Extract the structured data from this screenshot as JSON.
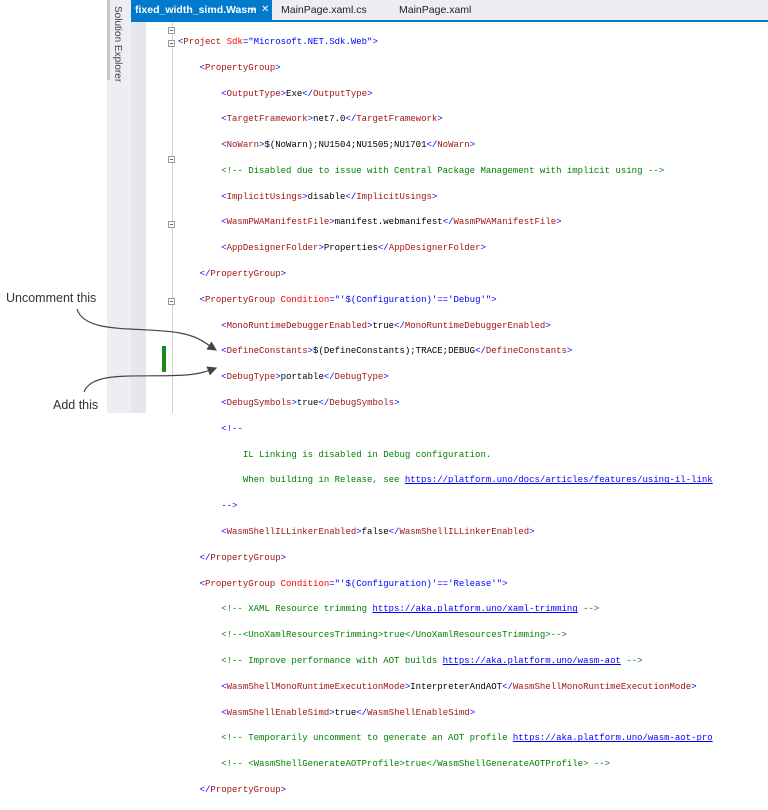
{
  "sidebar": {
    "solution_explorer": "Solution Explorer"
  },
  "tabs": [
    {
      "label": "fixed_width_simd.Wasm",
      "active": true,
      "pin_icon": "pin-icon",
      "close_icon": "close-icon"
    },
    {
      "label": "MainPage.xaml.cs"
    },
    {
      "label": "MainPage.xaml"
    }
  ],
  "annotations": {
    "uncomment": "Uncomment this",
    "add": "Add this"
  },
  "colors": {
    "accent": "#007acc",
    "tag": "#a31515",
    "bracket": "#0000ff",
    "comment": "#008000",
    "change_marker": "#1a8a1a"
  },
  "code": {
    "l0": [
      "<",
      "Project",
      " Sdk",
      "=\"Microsoft.NET.Sdk.Web\"",
      ">"
    ],
    "l1": [
      "PropertyGroup"
    ],
    "l2": [
      "OutputType",
      "Exe"
    ],
    "l3": [
      "TargetFramework",
      "net7.0"
    ],
    "l4": [
      "NoWarn",
      "$(NoWarn);NU1504;NU1505;NU1701"
    ],
    "l5": "<!-- Disabled due to issue with Central Package Management with implicit using -->",
    "l6": [
      "ImplicitUsings",
      "disable"
    ],
    "l7": [
      "WasmPWAManifestFile",
      "manifest.webmanifest"
    ],
    "l8": [
      "AppDesignerFolder",
      "Properties"
    ],
    "l9": "PropertyGroup",
    "l10": [
      "PropertyGroup",
      " Condition",
      "=\"'$(Configuration)'=='Debug'\""
    ],
    "l11": [
      "MonoRuntimeDebuggerEnabled",
      "true"
    ],
    "l12": [
      "DefineConstants",
      "$(DefineConstants);TRACE;DEBUG"
    ],
    "l13": [
      "DebugType",
      "portable"
    ],
    "l14": [
      "DebugSymbols",
      "true"
    ],
    "l15": "<!--",
    "l16": "IL Linking is disabled in Debug configuration.",
    "l17": [
      "When building in Release, see ",
      "https://platform.uno/docs/articles/features/using-il-link"
    ],
    "l18": "-->",
    "l19": [
      "WasmShellILLinkerEnabled",
      "false"
    ],
    "l20": "PropertyGroup",
    "l21": [
      "PropertyGroup",
      " Condition",
      "=\"'$(Configuration)'=='Release'\""
    ],
    "l22": [
      "<!-- XAML Resource trimming ",
      "https://aka.platform.uno/xaml-trimming",
      " -->"
    ],
    "l23": "<!--<UnoXamlResourcesTrimming>true</UnoXamlResourcesTrimming>-->",
    "l24": [
      "<!-- Improve performance with AOT builds ",
      "https://aka.platform.uno/wasm-aot",
      " -->"
    ],
    "l25": [
      "WasmShellMonoRuntimeExecutionMode",
      "InterpreterAndAOT"
    ],
    "l26": [
      "WasmShellEnableSimd",
      "true"
    ],
    "l27": [
      "<!-- Temporarily uncomment to generate an AOT profile ",
      "https://aka.platform.uno/wasm-aot-pro"
    ],
    "l28": "<!-- <WasmShellGenerateAOTProfile>true</WasmShellGenerateAOTProfile> -->",
    "l29": "PropertyGroup"
  }
}
